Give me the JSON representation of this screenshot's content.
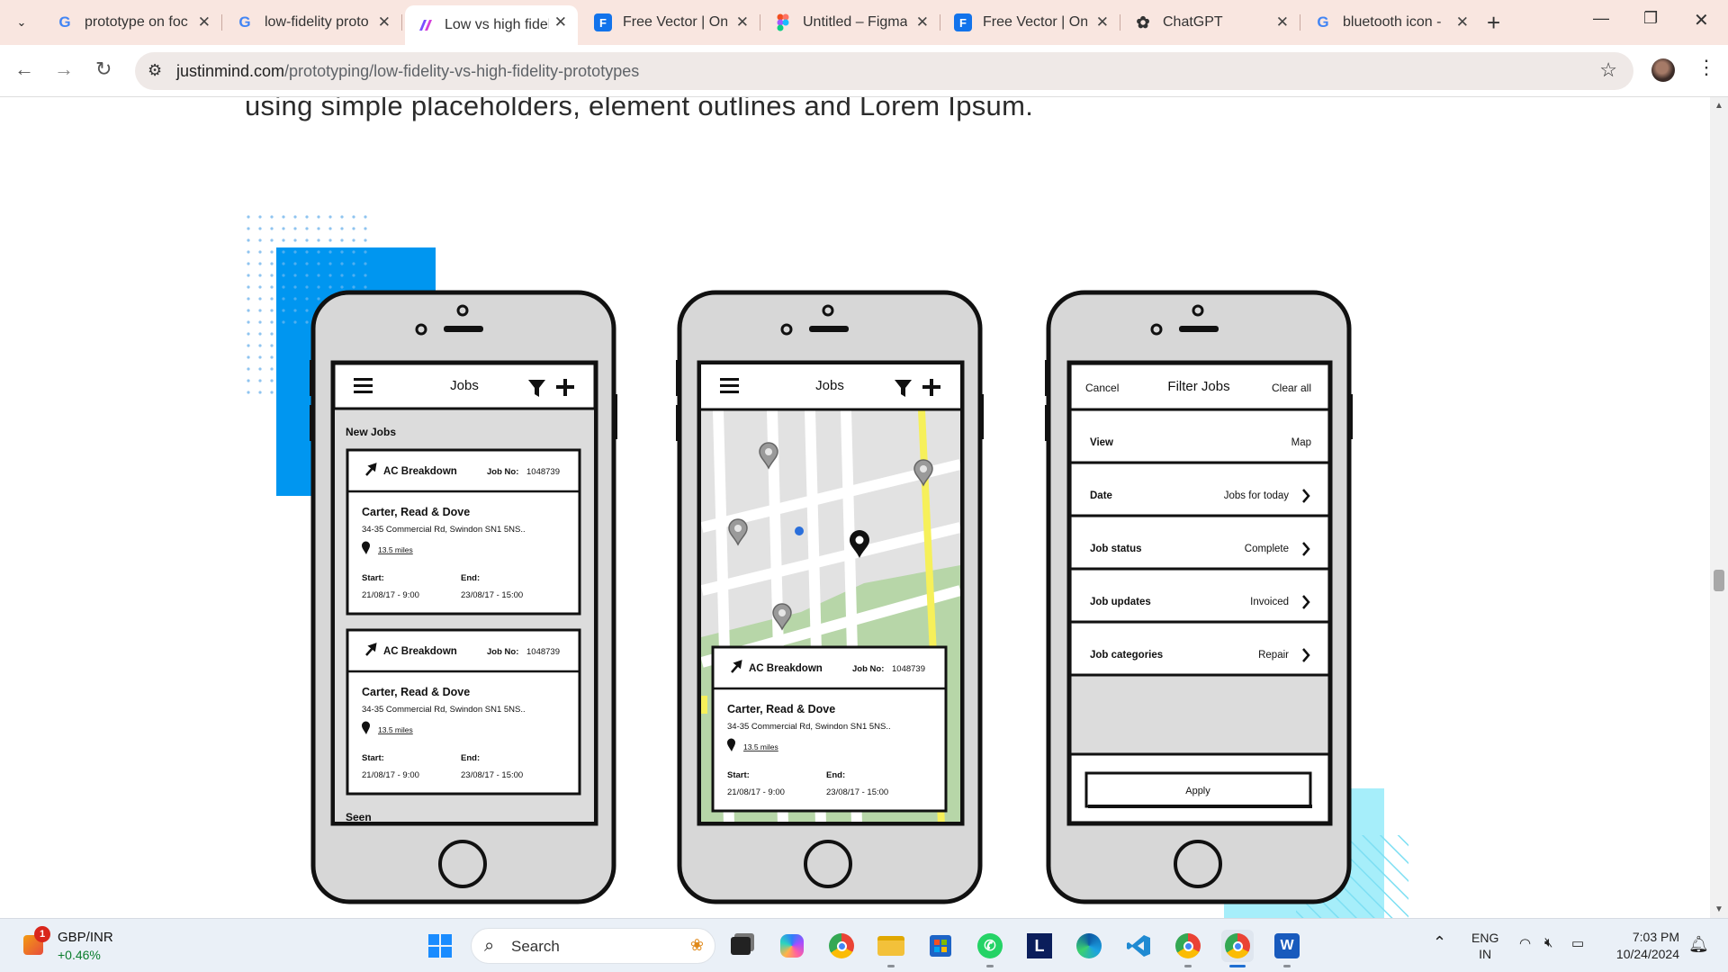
{
  "browser": {
    "tabs": [
      {
        "icon": "google-icon",
        "title": "prototype on foc",
        "active": false
      },
      {
        "icon": "google-icon",
        "title": "low-fidelity proto",
        "active": false
      },
      {
        "icon": "justinmind-icon",
        "title": "Low vs high fidel",
        "active": true
      },
      {
        "icon": "freepik-icon",
        "title": "Free Vector | Onl",
        "active": false
      },
      {
        "icon": "figma-icon",
        "title": "Untitled – Figma",
        "active": false
      },
      {
        "icon": "freepik-icon",
        "title": "Free Vector | Onl",
        "active": false
      },
      {
        "icon": "chatgpt-icon",
        "title": "ChatGPT",
        "active": false
      },
      {
        "icon": "google-icon",
        "title": "bluetooth icon -",
        "active": false
      }
    ],
    "url_host": "justinmind.com",
    "url_path": "/prototyping/low-fidelity-vs-high-fidelity-prototypes"
  },
  "page": {
    "intro_text": "using simple placeholders, element outlines and Lorem Ipsum."
  },
  "illustration": {
    "phone1": {
      "header_title": "Jobs",
      "section_label": "New Jobs",
      "cards": [
        {
          "job_type": "AC Breakdown",
          "job_no_label": "Job No:",
          "job_no": "1048739",
          "company": "Carter, Read & Dove",
          "address": "34-35 Commercial Rd, Swindon SN1 5NS..",
          "distance": "13.5 miles",
          "start_label": "Start:",
          "end_label": "End:",
          "start": "21/08/17 - 9:00",
          "end": "23/08/17 - 15:00"
        },
        {
          "job_type": "AC Breakdown",
          "job_no_label": "Job No:",
          "job_no": "1048739",
          "company": "Carter, Read & Dove",
          "address": "34-35 Commercial Rd, Swindon SN1 5NS..",
          "distance": "13.5 miles",
          "start_label": "Start:",
          "end_label": "End:",
          "start": "21/08/17 - 9:00",
          "end": "23/08/17 - 15:00"
        }
      ],
      "footer_label": "Seen"
    },
    "phone2": {
      "header_title": "Jobs",
      "card": {
        "job_type": "AC Breakdown",
        "job_no_label": "Job No:",
        "job_no": "1048739",
        "company": "Carter, Read & Dove",
        "address": "34-35 Commercial Rd, Swindon SN1 5NS..",
        "distance": "13.5 miles",
        "start_label": "Start:",
        "end_label": "End:",
        "start": "21/08/17 - 9:00",
        "end": "23/08/17 - 15:00"
      }
    },
    "phone3": {
      "cancel_label": "Cancel",
      "title": "Filter Jobs",
      "clear_label": "Clear all",
      "rows": [
        {
          "label": "View",
          "value": "Map",
          "chevron": false
        },
        {
          "label": "Date",
          "value": "Jobs for today",
          "chevron": true
        },
        {
          "label": "Job status",
          "value": "Complete",
          "chevron": true
        },
        {
          "label": "Job updates",
          "value": "Invoiced",
          "chevron": true
        },
        {
          "label": "Job categories",
          "value": "Repair",
          "chevron": true
        }
      ],
      "apply_label": "Apply"
    }
  },
  "taskbar": {
    "widget_title": "GBP/INR",
    "widget_change": "+0.46%",
    "widget_badge": "1",
    "search_placeholder": "Search",
    "lang_line1": "ENG",
    "lang_line2": "IN",
    "time": "7:03 PM",
    "date": "10/24/2024"
  },
  "colors": {
    "tabbar_bg": "#f9e6e0",
    "accent_blue": "#0096f0",
    "accent_cyan": "#a6eefa",
    "map_highlight": "#f6f05a"
  }
}
